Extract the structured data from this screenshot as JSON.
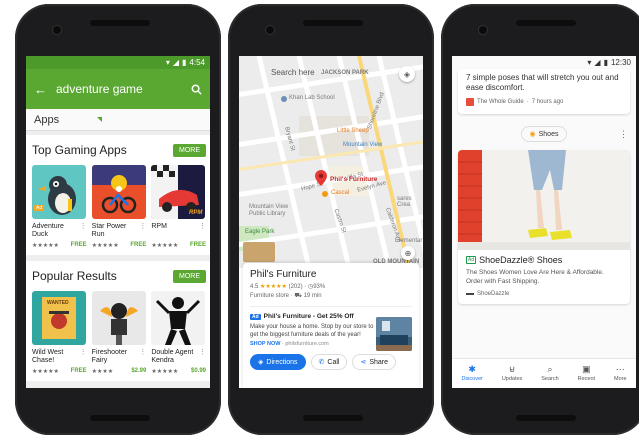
{
  "phones": {
    "play": {
      "status_time": "4:54",
      "search_query": "adventure game",
      "filter_label": "Apps",
      "sections": [
        {
          "title": "Top Gaming Apps",
          "more_label": "MORE",
          "apps": [
            {
              "name": "Adventure Duck",
              "stars": "★★★★★",
              "price": "FREE"
            },
            {
              "name": "Star Power Run",
              "stars": "★★★★★",
              "price": "FREE"
            },
            {
              "name": "RPM",
              "stars": "★★★★★",
              "price": "FREE"
            }
          ]
        },
        {
          "title": "Popular Results",
          "more_label": "MORE",
          "apps": [
            {
              "name": "Wild West Chase!",
              "stars": "★★★★★",
              "price": "FREE"
            },
            {
              "name": "Fireshooter Fairy",
              "stars": "★★★★",
              "price": "$2.99"
            },
            {
              "name": "Double Agent Kendra",
              "stars": "★★★★★",
              "price": "$0.99"
            }
          ]
        }
      ],
      "thumb_text": {
        "ad_badge": "Ad",
        "rpm_logo": "RPM",
        "wanted": "WANTED"
      }
    },
    "maps": {
      "search_here": "Search here",
      "map_labels": {
        "jackson_park": "JACKSON PARK",
        "khan_lab": "Khan Lab School",
        "little_sheep": "Little Sheep",
        "mountain_view": "Mountain View",
        "pin": "Phil's Furniture",
        "cascal": "Cascal",
        "library": "Mountain View\nPublic Library",
        "eagle_park": "Eagle Park",
        "old_mountain": "OLD MOUNTAIN\nVIEW",
        "elementary": "Elementar",
        "bryant": "Bryant St",
        "shoreline": "Shoreline Blvd",
        "hope": "Hope St",
        "evelyn": "Evelyn Ave",
        "villa": "Villa St",
        "calderon": "Calderon Ave",
        "castro": "Castro St",
        "sares": "sares Crea"
      },
      "business": {
        "name": "Phil's Furniture",
        "rating": "4.5",
        "stars": "★★★★★",
        "reviews": "(202)",
        "percent": "93%",
        "category": "Furniture store",
        "drive": "19 min"
      },
      "ad": {
        "badge": "Ad",
        "title": "Phil's Furniture - Get 25% Off",
        "body": "Make your house a home. Stop by our store to get the biggest furniture deals of the year!",
        "cta": "SHOP NOW",
        "domain": "philsfurniture.com"
      },
      "actions": {
        "directions": "Directions",
        "call": "Call",
        "share": "Share"
      }
    },
    "discover": {
      "status_time": "12:30",
      "article": {
        "text": "7 simple poses that will stretch you out and ease discomfort.",
        "source": "The Whole Guide",
        "age": "7 hours ago"
      },
      "topic": "Shoes",
      "ad": {
        "badge": "Ad",
        "title": "ShoeDazzle® Shoes",
        "body": "The Shoes Women Love Are Here & Affordable. Order with Fast Shipping.",
        "source": "ShoeDazzle"
      },
      "nav": [
        {
          "label": "Discover",
          "icon": "asterisk-icon"
        },
        {
          "label": "Updates",
          "icon": "inbox-icon"
        },
        {
          "label": "Search",
          "icon": "search-icon"
        },
        {
          "label": "Recent",
          "icon": "tabs-icon"
        },
        {
          "label": "More",
          "icon": "more-icon"
        }
      ]
    }
  },
  "colors": {
    "play_green": "#5aa831",
    "google_blue": "#1a73e8",
    "map_red": "#e53935"
  }
}
